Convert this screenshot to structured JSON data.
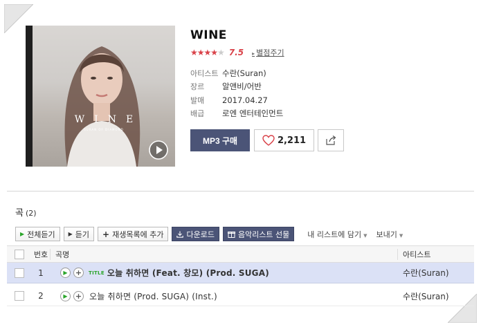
{
  "album": {
    "title": "WINE",
    "rating_stars_on": "★★★★",
    "rating_stars_off": "★",
    "rating_value": "7.5",
    "rate_link": "별점주기",
    "cover_word": "WINE",
    "cover_sub": "SURAN OF DIAMOND",
    "meta": [
      {
        "key": "아티스트",
        "value": "수란(Suran)"
      },
      {
        "key": "장르",
        "value": "알앤비/어반"
      },
      {
        "key": "발매",
        "value": "2017.04.27"
      },
      {
        "key": "배급",
        "value": "로엔 엔터테인먼트"
      }
    ],
    "buy_label": "MP3 구매",
    "like_count": "2,211"
  },
  "songs_section": {
    "label": "곡",
    "count": "(2)"
  },
  "toolbar": {
    "play_all": "전체듣기",
    "play": "듣기",
    "add_playlist": "재생목록에 추가",
    "download": "다운로드",
    "gift": "음악리스트 선물",
    "add_mylist": "내 리스트에 담기",
    "send": "보내기"
  },
  "table": {
    "headers": {
      "num": "번호",
      "name": "곡명",
      "artist": "아티스트"
    },
    "rows": [
      {
        "num": "1",
        "badge": "TITLE",
        "name": "오늘 취하면 (Feat. 창모) (Prod. SUGA)",
        "artist": "수란(Suran)",
        "selected": true
      },
      {
        "num": "2",
        "badge": "",
        "name": "오늘 취하면 (Prod. SUGA) (Inst.)",
        "artist": "수란(Suran)",
        "selected": false
      }
    ]
  },
  "colors": {
    "accent_dark": "#4b5477",
    "rating_red": "#d94249",
    "play_green": "#2aa52a",
    "selected_row": "#dbe1f6"
  }
}
